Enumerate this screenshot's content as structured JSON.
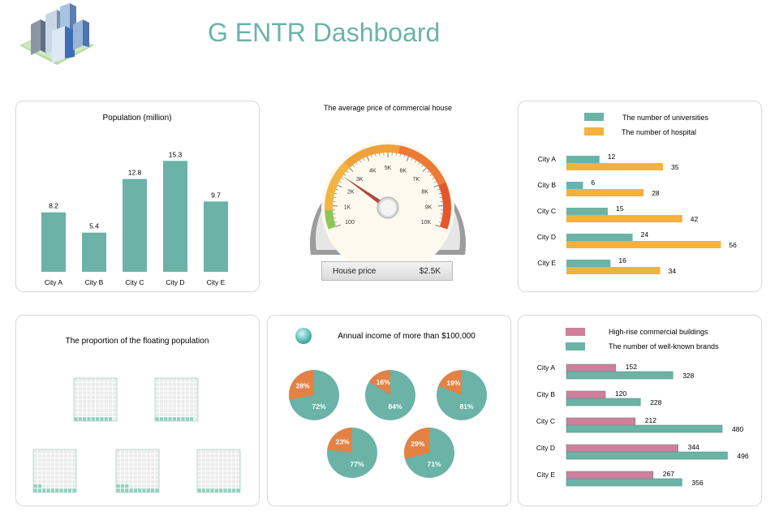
{
  "header": {
    "title": "G ENTR Dashboard",
    "logo_icon": "city-buildings-icon"
  },
  "population": {
    "title": "Population (million)",
    "chart_data": {
      "type": "bar",
      "title": "Population (million)",
      "categories": [
        "City A",
        "City B",
        "City C",
        "City D",
        "City E"
      ],
      "values": [
        8.2,
        5.4,
        12.8,
        15.3,
        9.7
      ],
      "ylim": [
        0,
        16
      ],
      "color": "#6ab3a6"
    }
  },
  "gauge": {
    "title": "The average price of commercial house",
    "ticks": [
      "100",
      "1K",
      "2K",
      "3K",
      "4K",
      "5K",
      "6K",
      "7K",
      "8K",
      "9K",
      "10K"
    ],
    "box_label": "House price",
    "box_value": "$2.5K",
    "value": 2.5,
    "max": 10
  },
  "universities": {
    "legend": [
      "The number of universities",
      "The number of hospital"
    ],
    "chart_data": {
      "type": "bar",
      "orientation": "horizontal",
      "categories": [
        "City A",
        "City B",
        "City C",
        "City D",
        "City E"
      ],
      "series": [
        {
          "name": "The number of universities",
          "values": [
            12,
            6,
            15,
            24,
            16
          ],
          "color": "#6ab3a6"
        },
        {
          "name": "The number of hospital",
          "values": [
            35,
            28,
            42,
            56,
            34
          ],
          "color": "#f4b140"
        }
      ]
    }
  },
  "floating": {
    "title": "The proportion of the floating population",
    "chart_data": {
      "type": "waffle",
      "values": [
        0.09,
        0.09,
        0.12,
        0.13,
        0.1
      ]
    }
  },
  "income": {
    "title": "Annual income of more than $100,000",
    "legend_icon": "teal-sphere-icon",
    "chart_data": {
      "type": "pie",
      "pies": [
        {
          "a": 28,
          "b": 72,
          "a_label": "28%",
          "b_label": "72%"
        },
        {
          "a": 16,
          "b": 84,
          "a_label": "16%",
          "b_label": "84%"
        },
        {
          "a": 19,
          "b": 81,
          "a_label": "19%",
          "b_label": "81%"
        },
        {
          "a": 23,
          "b": 77,
          "a_label": "23%",
          "b_label": "77%"
        },
        {
          "a": 29,
          "b": 71,
          "a_label": "29%",
          "b_label": "71%"
        }
      ],
      "colors": [
        "#e38244",
        "#6ab3a6"
      ]
    }
  },
  "commercial": {
    "legend": [
      "High-rise commercial buildings",
      "The number of well-known brands"
    ],
    "chart_data": {
      "type": "bar",
      "orientation": "horizontal",
      "categories": [
        "City A",
        "City B",
        "City C",
        "City D",
        "City E"
      ],
      "series": [
        {
          "name": "High-rise commercial buildings",
          "values": [
            152,
            120,
            212,
            344,
            267
          ],
          "color": "#d07f9b"
        },
        {
          "name": "The number of well-known brands",
          "values": [
            328,
            228,
            480,
            496,
            356
          ],
          "color": "#6ab3a6"
        }
      ]
    }
  }
}
